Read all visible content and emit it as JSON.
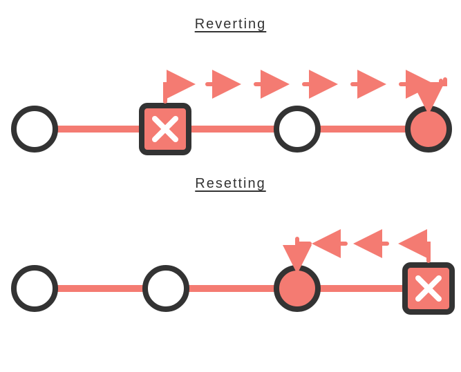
{
  "colors": {
    "coral": "#f47b72",
    "dark": "#333333",
    "white": "#ffffff"
  },
  "titles": {
    "reverting": "Reverting",
    "resetting": "Resetting"
  },
  "diagrams": {
    "reverting": {
      "description": "Four commits on a timeline. The 2nd commit is a crossed-out square (bad commit). Arrows jump forward from it over the 3rd commit to a new coral-filled 4th commit — reverting creates a new commit that undoes it.",
      "nodes": [
        {
          "kind": "circle",
          "fill": "white"
        },
        {
          "kind": "square-x",
          "fill": "coral"
        },
        {
          "kind": "circle",
          "fill": "white"
        },
        {
          "kind": "circle",
          "fill": "coral"
        }
      ],
      "arrow_direction": "right"
    },
    "resetting": {
      "description": "Four commits on a timeline. The 4th commit is a crossed-out square (bad commit). Arrows go backward from it to the coral-filled 3rd commit — resetting moves HEAD back, discarding it.",
      "nodes": [
        {
          "kind": "circle",
          "fill": "white"
        },
        {
          "kind": "circle",
          "fill": "white"
        },
        {
          "kind": "circle",
          "fill": "coral"
        },
        {
          "kind": "square-x",
          "fill": "coral"
        }
      ],
      "arrow_direction": "left"
    }
  }
}
